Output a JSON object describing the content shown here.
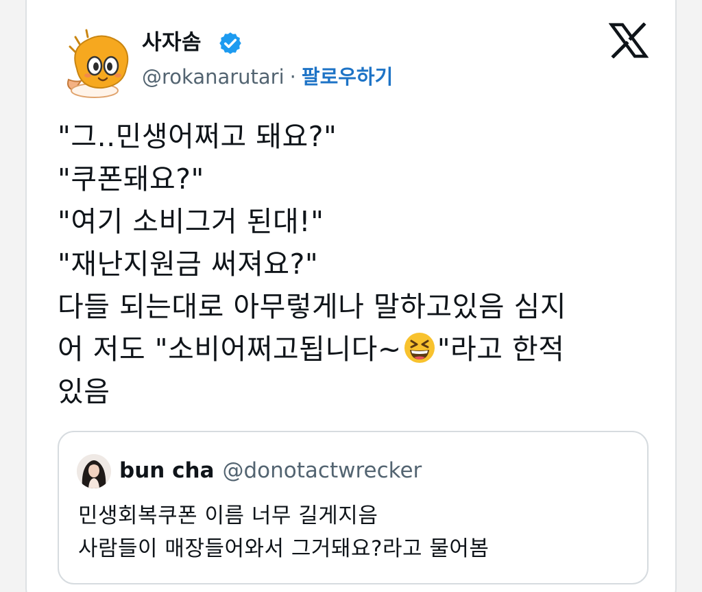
{
  "author": {
    "display_name": "사자솜",
    "handle": "@rokanarutari",
    "separator": "·",
    "follow_label": "팔로우하기",
    "verified": true,
    "avatar_icon": "orange-lion-cartoon-avatar"
  },
  "platform_icon": "x-logo-icon",
  "tweet": {
    "lines": [
      "\"그..민생어쩌고 돼요?\"",
      "\"쿠폰돼요?\"",
      "\"여기 소비그거 된대!\"",
      "\"재난지원금 써져요?\"",
      "다들 되는대로 아무렇게나 말하고있음 심지",
      "어 저도 \"소비어쩌고됩니다~",
      "\"라고 한적",
      "있음"
    ],
    "emoji": "grinning-squinting-face-emoji"
  },
  "quoted": {
    "display_name": "bun cha",
    "handle": "@donotactwrecker",
    "lines": [
      "민생회복쿠폰 이름 너무 길게지음",
      "사람들이 매장들어와서 그거돼요?라고 물어봄"
    ],
    "avatar_icon": "user-photo-avatar"
  },
  "colors": {
    "link_blue": "#1d73c6",
    "verified_blue": "#1d9bf0",
    "secondary_text": "#536471",
    "border": "#d6dbdf"
  }
}
